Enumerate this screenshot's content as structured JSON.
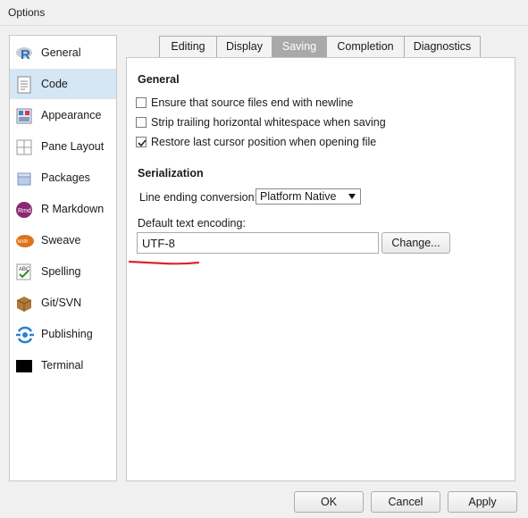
{
  "window": {
    "title": "Options"
  },
  "sidebar": {
    "items": [
      {
        "label": "General",
        "icon": "r-logo-icon"
      },
      {
        "label": "Code",
        "icon": "code-page-icon",
        "selected": true
      },
      {
        "label": "Appearance",
        "icon": "appearance-icon"
      },
      {
        "label": "Pane Layout",
        "icon": "pane-layout-icon"
      },
      {
        "label": "Packages",
        "icon": "packages-icon"
      },
      {
        "label": "R Markdown",
        "icon": "rmarkdown-icon"
      },
      {
        "label": "Sweave",
        "icon": "sweave-icon"
      },
      {
        "label": "Spelling",
        "icon": "spelling-icon"
      },
      {
        "label": "Git/SVN",
        "icon": "git-svn-icon"
      },
      {
        "label": "Publishing",
        "icon": "publishing-icon"
      },
      {
        "label": "Terminal",
        "icon": "terminal-icon"
      }
    ]
  },
  "tabs": [
    {
      "label": "Editing"
    },
    {
      "label": "Display"
    },
    {
      "label": "Saving",
      "active": true
    },
    {
      "label": "Completion"
    },
    {
      "label": "Diagnostics"
    }
  ],
  "saving": {
    "general_heading": "General",
    "checkboxes": [
      {
        "label": "Ensure that source files end with newline",
        "checked": false
      },
      {
        "label": "Strip trailing horizontal whitespace when saving",
        "checked": false
      },
      {
        "label": "Restore last cursor position when opening file",
        "checked": true
      }
    ],
    "serialization_heading": "Serialization",
    "line_ending_label": "Line ending conversion:",
    "line_ending_value": "Platform Native",
    "encoding_label": "Default text encoding:",
    "encoding_value": "UTF-8",
    "change_button": "Change..."
  },
  "footer": {
    "ok": "OK",
    "cancel": "Cancel",
    "apply": "Apply"
  },
  "colors": {
    "selected_bg": "#d5e6f4",
    "active_tab": "#a9a9a9",
    "annotation": "#d9272e"
  }
}
